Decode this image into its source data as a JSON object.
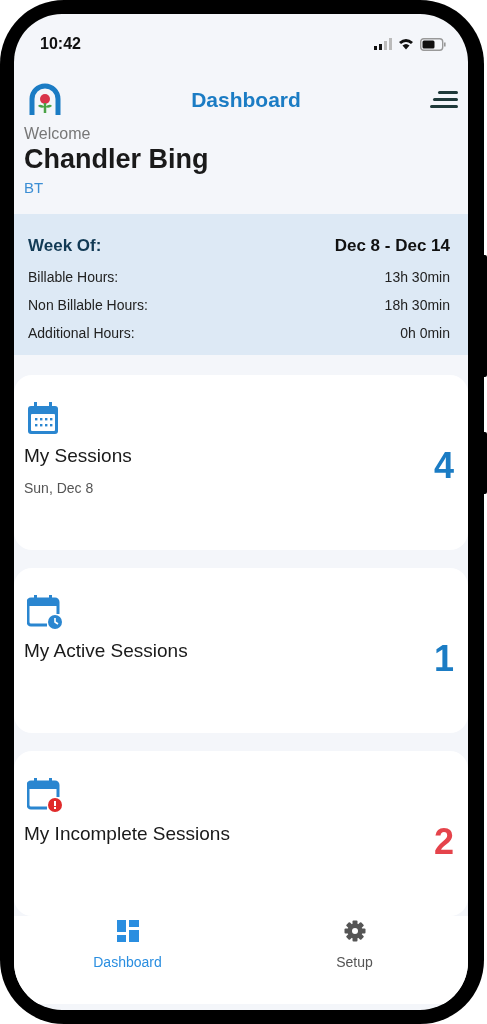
{
  "status_bar": {
    "time": "10:42"
  },
  "header": {
    "title": "Dashboard"
  },
  "welcome": {
    "greeting": "Welcome",
    "name": "Chandler Bing",
    "initials": "BT"
  },
  "week_summary": {
    "label": "Week Of:",
    "range": "Dec 8 - Dec 14",
    "rows": [
      {
        "label": "Billable Hours:",
        "value": "13h 30min"
      },
      {
        "label": "Non Billable Hours:",
        "value": "18h 30min"
      },
      {
        "label": "Additional Hours:",
        "value": "0h 0min"
      }
    ]
  },
  "cards": [
    {
      "kind": "calendar",
      "title": "My Sessions",
      "subtitle": "Sun, Dec 8",
      "count": "4",
      "color": "#1b7cc4"
    },
    {
      "kind": "calendar-clock",
      "title": "My Active Sessions",
      "count": "1",
      "color": "#1b7cc4"
    },
    {
      "kind": "calendar-alert",
      "title": "My Incomplete Sessions",
      "count": "2",
      "color": "#e5434b"
    }
  ],
  "bottom_nav": [
    {
      "kind": "dashboard",
      "label": "Dashboard",
      "selected": true
    },
    {
      "kind": "setup",
      "label": "Setup",
      "selected": false
    }
  ]
}
